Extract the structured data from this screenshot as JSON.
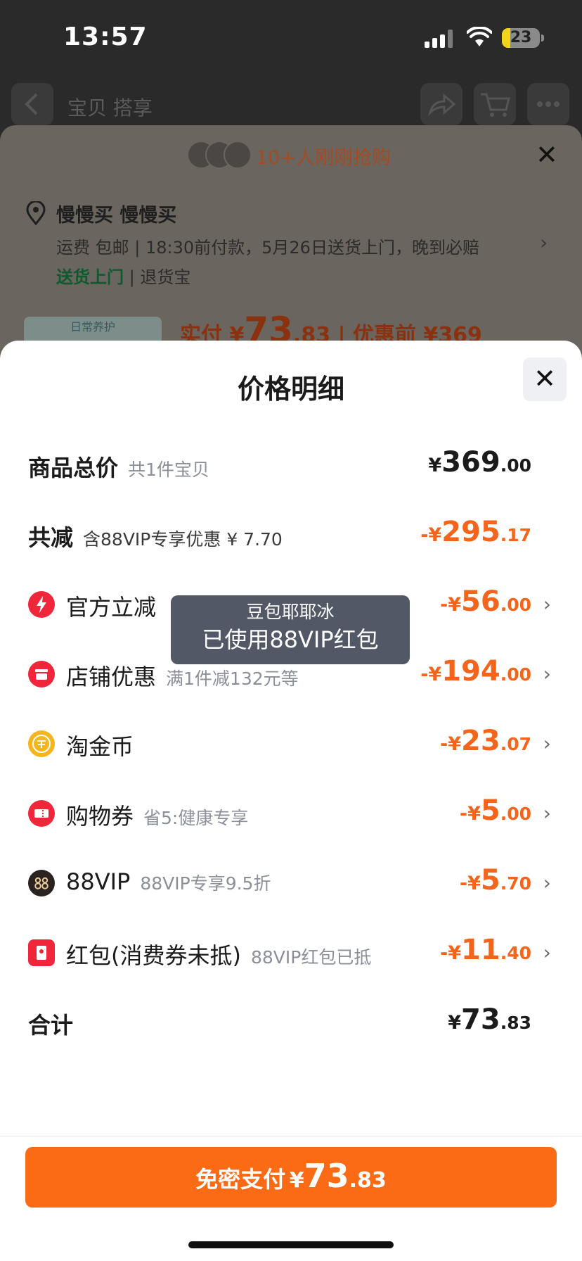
{
  "status": {
    "time": "13:57",
    "battery": "23",
    "battery_level": 0.23
  },
  "nav": {
    "title": "宝贝  搭享"
  },
  "background_sheet": {
    "buyers_text": "10+人刚刚抢购",
    "address_name": "慢慢买 慢慢买",
    "shipping_line": "运费 包邮 | 18:30前付款，5月26日送货上门，晚到必赔",
    "service_green": "送货上门",
    "service_other": " | 退货宝",
    "promo_text": "日常养护",
    "price_prefix": "实付 ¥",
    "price_int": "73",
    "price_dec": ".83",
    "price_suffix": " | 优惠前 ¥369"
  },
  "sheet": {
    "title": "价格明细",
    "rows": [
      {
        "label": "商品总价",
        "sub": "共1件宝贝",
        "cur": "¥",
        "int": "369",
        "dec": ".00"
      },
      {
        "label": "共减",
        "sub": "含88VIP专享优惠 ¥ 7.70",
        "cur": "-¥",
        "int": "295",
        "dec": ".17"
      },
      {
        "label": "官方立减",
        "sub": "",
        "cur": "-¥",
        "int": "56",
        "dec": ".00",
        "icon": "lightning-icon"
      },
      {
        "label": "店铺优惠",
        "sub": "满1件减132元等",
        "cur": "-¥",
        "int": "194",
        "dec": ".00",
        "icon": "shop-icon"
      },
      {
        "label": "淘金币",
        "sub": "",
        "cur": "-¥",
        "int": "23",
        "dec": ".07",
        "icon": "coin-icon"
      },
      {
        "label": "购物券",
        "sub": "省5:健康专享",
        "cur": "-¥",
        "int": "5",
        "dec": ".00",
        "icon": "coupon-icon"
      },
      {
        "label": "88VIP",
        "sub": "88VIP专享9.5折",
        "cur": "-¥",
        "int": "5",
        "dec": ".70",
        "icon": "vip88-icon"
      },
      {
        "label": "红包(消费券未抵)",
        "sub": "88VIP红包已抵",
        "cur": "-¥",
        "int": "11",
        "dec": ".40",
        "icon": "redpacket-icon"
      },
      {
        "label": "合计",
        "sub": "",
        "cur": "¥",
        "int": "73",
        "dec": ".83"
      }
    ]
  },
  "toast": {
    "line1": "豆包耶耶冰",
    "line2": "已使用88VIP红包"
  },
  "pay_button": {
    "label": "免密支付",
    "cur": "¥",
    "int": "73",
    "dec": ".83"
  },
  "colors": {
    "accent": "#fb6a14",
    "discount": "#f4651b",
    "green": "#0d5a2e"
  }
}
